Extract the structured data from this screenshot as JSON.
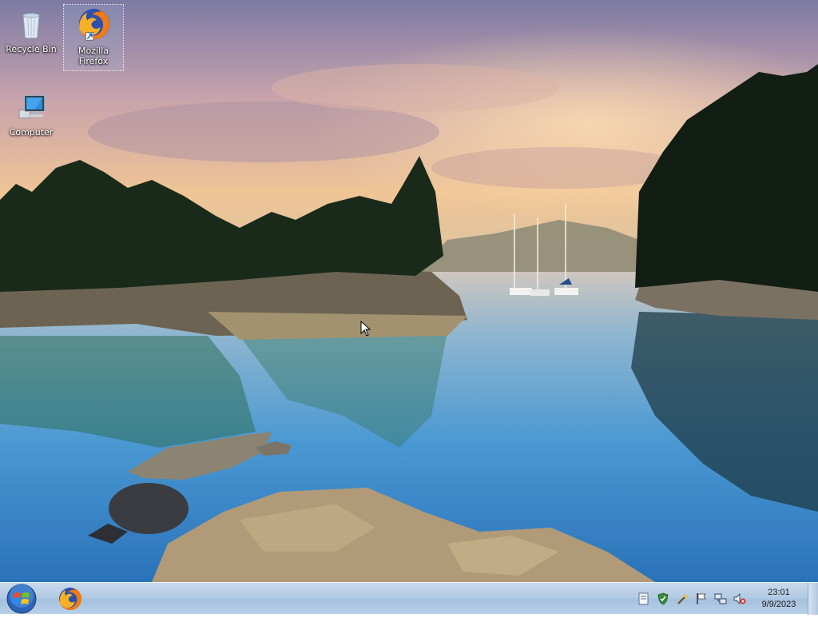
{
  "desktop": {
    "icons": [
      {
        "label": "Recycle Bin",
        "icon": "recycle-bin-icon"
      },
      {
        "label": "Mozilla Firefox",
        "icon": "firefox-icon",
        "selected": true
      },
      {
        "label": "Computer",
        "icon": "computer-icon"
      }
    ]
  },
  "taskbar": {
    "start_icon": "windows-logo-icon",
    "pinned": [
      {
        "app": "Mozilla Firefox",
        "icon": "firefox-icon"
      }
    ],
    "tray_icons": [
      "action-center-icon",
      "security-shield-icon",
      "troubleshoot-wand-icon",
      "flag-icon",
      "network-icon",
      "volume-muted-icon"
    ],
    "clock": {
      "time": "23:01",
      "date": "9/9/2023"
    }
  },
  "colors": {
    "taskbar": "#b3cbe4",
    "water": "#3f86c4",
    "sky": "#e3b997"
  }
}
